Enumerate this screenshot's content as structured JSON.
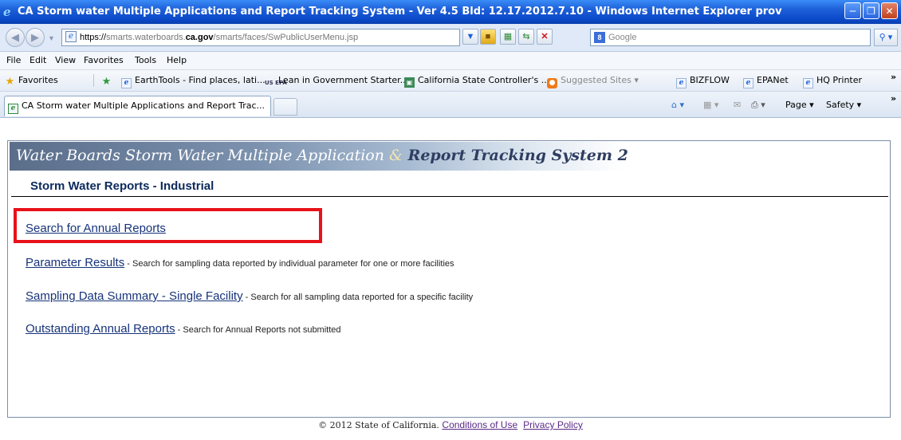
{
  "window": {
    "title": "CA Storm water Multiple Applications and Report Tracking System - Ver 4.5 Bld: 12.17.2012.7.10 - Windows Internet Explorer prov"
  },
  "address": {
    "url_prefix": "https://",
    "url_host": "smarts.waterboards.",
    "url_host_bold": "ca.gov",
    "url_path": "/smarts/faces/SwPublicUserMenu.jsp"
  },
  "search": {
    "placeholder": "Google"
  },
  "menu": [
    "File",
    "Edit",
    "View",
    "Favorites",
    "Tools",
    "Help"
  ],
  "favorites": {
    "label": "Favorites",
    "items": [
      "EarthTools - Find places, lati...",
      "Lean in Government Starter...",
      "California State Controller's ...",
      "Suggested Sites ▾",
      "BIZFLOW",
      "EPANet",
      "HQ Printer"
    ],
    "epa_icon": "US EPA"
  },
  "tab": {
    "label": "CA Storm water Multiple Applications and Report Trac..."
  },
  "commands": {
    "page": "Page ▾",
    "safety": "Safety ▾"
  },
  "page": {
    "banner": {
      "part1": "Water Boards  Storm Water Multiple Application ",
      "amp": "&",
      "part2": " Report Tracking System 2"
    },
    "subheading": "Storm Water Reports - Industrial",
    "links": [
      {
        "label": "Search for Annual Reports",
        "desc": ""
      },
      {
        "label": "Parameter Results",
        "desc": " - Search for sampling data reported by individual parameter for one or more facilities"
      },
      {
        "label": "Sampling Data Summary - Single Facility",
        "desc": " - Search for all sampling data reported for a specific facility"
      },
      {
        "label": "Outstanding Annual Reports",
        "desc": " - Search for Annual Reports not submitted"
      }
    ]
  },
  "footer": {
    "copyright": "© 2012 State of California.",
    "conditions": "Conditions of Use",
    "privacy": "Privacy Policy"
  },
  "colors": {
    "highlight": "#e8121a",
    "link": "#16337a",
    "titlebar": "#1d5fd8"
  }
}
